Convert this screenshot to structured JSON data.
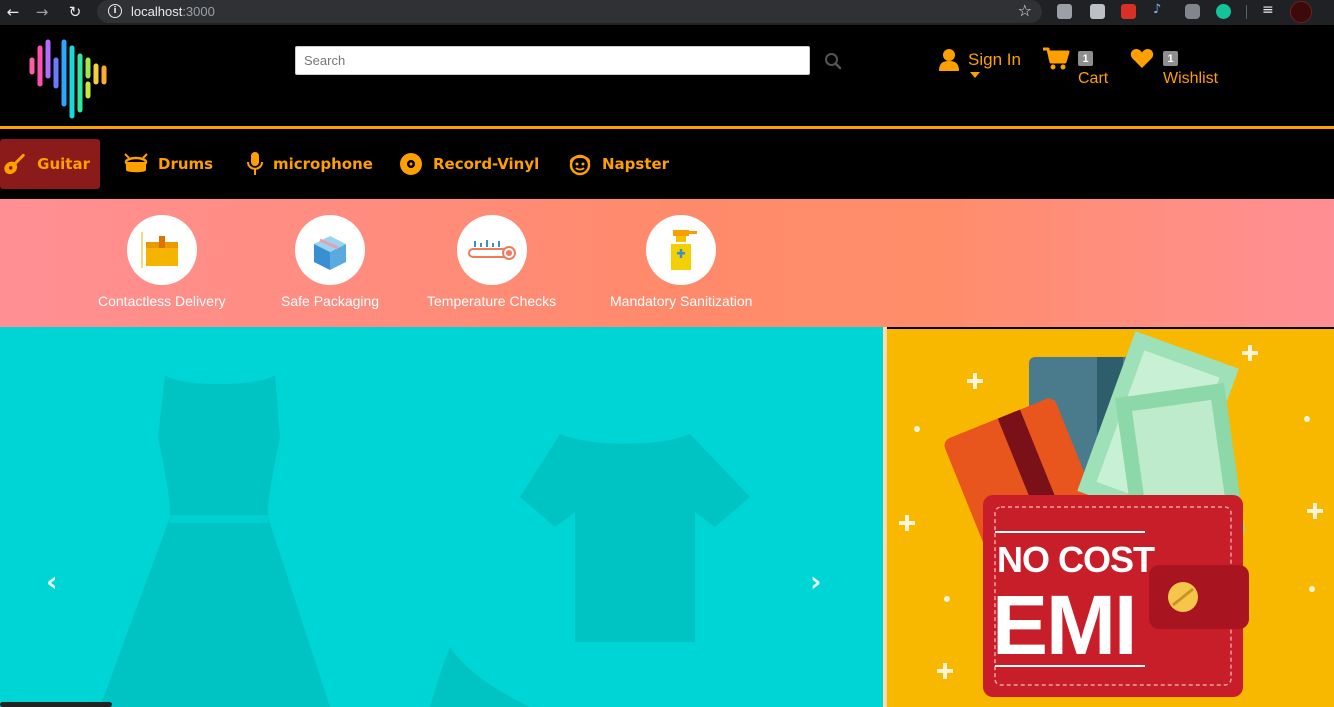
{
  "browser": {
    "url_host": "localhost",
    "url_port": ":3000"
  },
  "header": {
    "search_placeholder": "Search",
    "signin_label": "Sign In",
    "cart_label": "Cart",
    "cart_count": "1",
    "wishlist_label": "Wishlist",
    "wishlist_count": "1"
  },
  "categories": [
    {
      "label": "Guitar",
      "icon": "guitar-icon",
      "active": true
    },
    {
      "label": "Drums",
      "icon": "drum-icon",
      "active": false
    },
    {
      "label": "microphone",
      "icon": "microphone-icon",
      "active": false
    },
    {
      "label": "Record-Vinyl",
      "icon": "record-vinyl-icon",
      "active": false
    },
    {
      "label": "Napster",
      "icon": "napster-icon",
      "active": false
    }
  ],
  "features": [
    {
      "label": "Contactless Delivery",
      "icon": "package-icon"
    },
    {
      "label": "Safe Packaging",
      "icon": "box-icon"
    },
    {
      "label": "Temperature Checks",
      "icon": "thermometer-icon"
    },
    {
      "label": "Mandatory Sanitization",
      "icon": "sanitizer-icon"
    }
  ],
  "promo": {
    "line1": "NO COST",
    "line2": "EMI"
  },
  "colors": {
    "accent": "#ff9f00",
    "active_category_bg": "#8b1a1a",
    "carousel_bg": "#00d5d5",
    "emi_bg": "#f9b800"
  }
}
